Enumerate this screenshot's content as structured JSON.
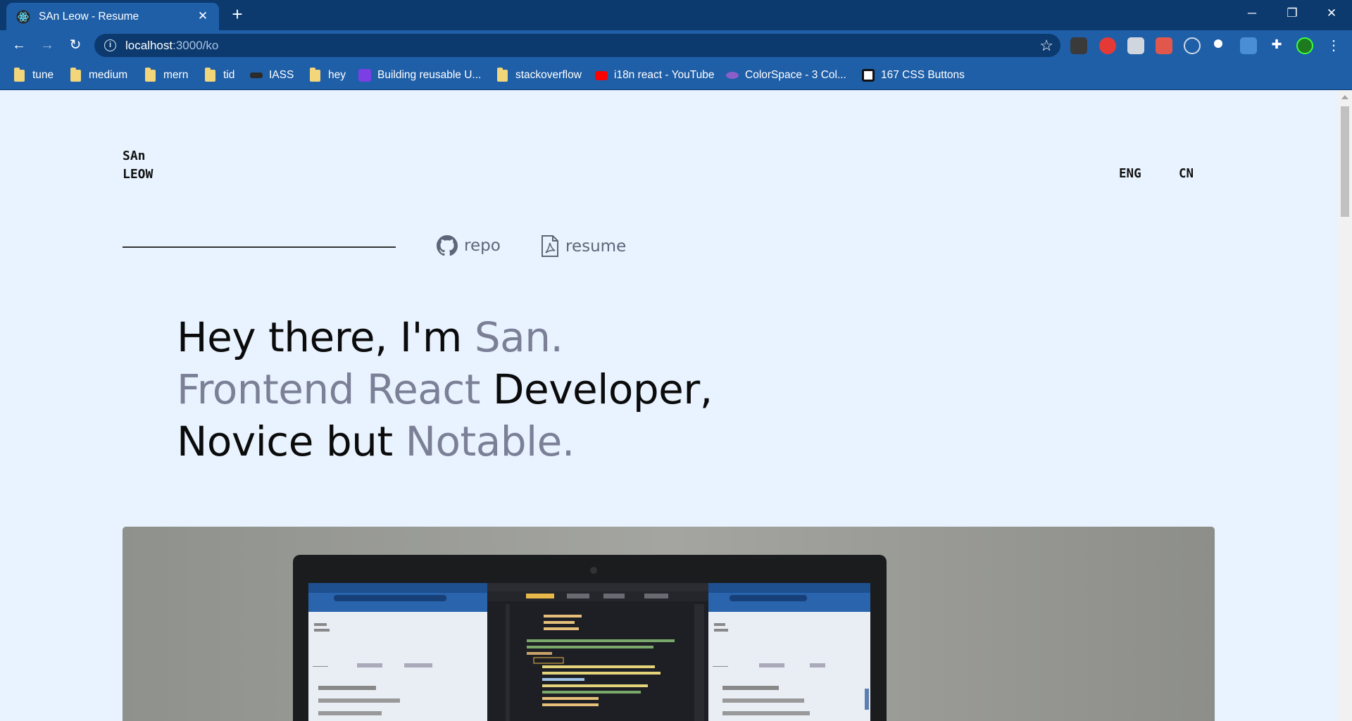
{
  "browser": {
    "tab_title": "SAn Leow - Resume",
    "url_host": "localhost",
    "url_path": ":3000/ko",
    "bookmarks": [
      {
        "label": "tune",
        "icon": "folder-icon"
      },
      {
        "label": "medium",
        "icon": "folder-icon"
      },
      {
        "label": "mern",
        "icon": "folder-icon"
      },
      {
        "label": "tid",
        "icon": "folder-icon"
      },
      {
        "label": "IASS",
        "icon": "site-icon"
      },
      {
        "label": "hey",
        "icon": "folder-icon"
      },
      {
        "label": "Building reusable U...",
        "icon": "rocket-icon"
      },
      {
        "label": "stackoverflow",
        "icon": "folder-icon"
      },
      {
        "label": "i18n react - YouTube",
        "icon": "youtube-icon"
      },
      {
        "label": "ColorSpace - 3 Col...",
        "icon": "planet-icon"
      },
      {
        "label": "167 CSS Buttons",
        "icon": "f-icon"
      }
    ]
  },
  "site": {
    "logo_line1": "SAn",
    "logo_line2": "LEOW",
    "lang_eng": "ENG",
    "lang_cn": "CN",
    "repo_label": "repo",
    "resume_label": "resume",
    "headline": {
      "line1_a": "Hey there, I'm ",
      "line1_b": "San.",
      "line2_a": "Frontend React",
      "line2_b": " Developer,",
      "line3_a": "Novice but ",
      "line3_b": "Notable."
    }
  },
  "colors": {
    "chrome_dark": "#0c3a6e",
    "chrome": "#1f5fa8",
    "page_bg": "#e8f3ff",
    "muted_text": "#7b8097"
  }
}
